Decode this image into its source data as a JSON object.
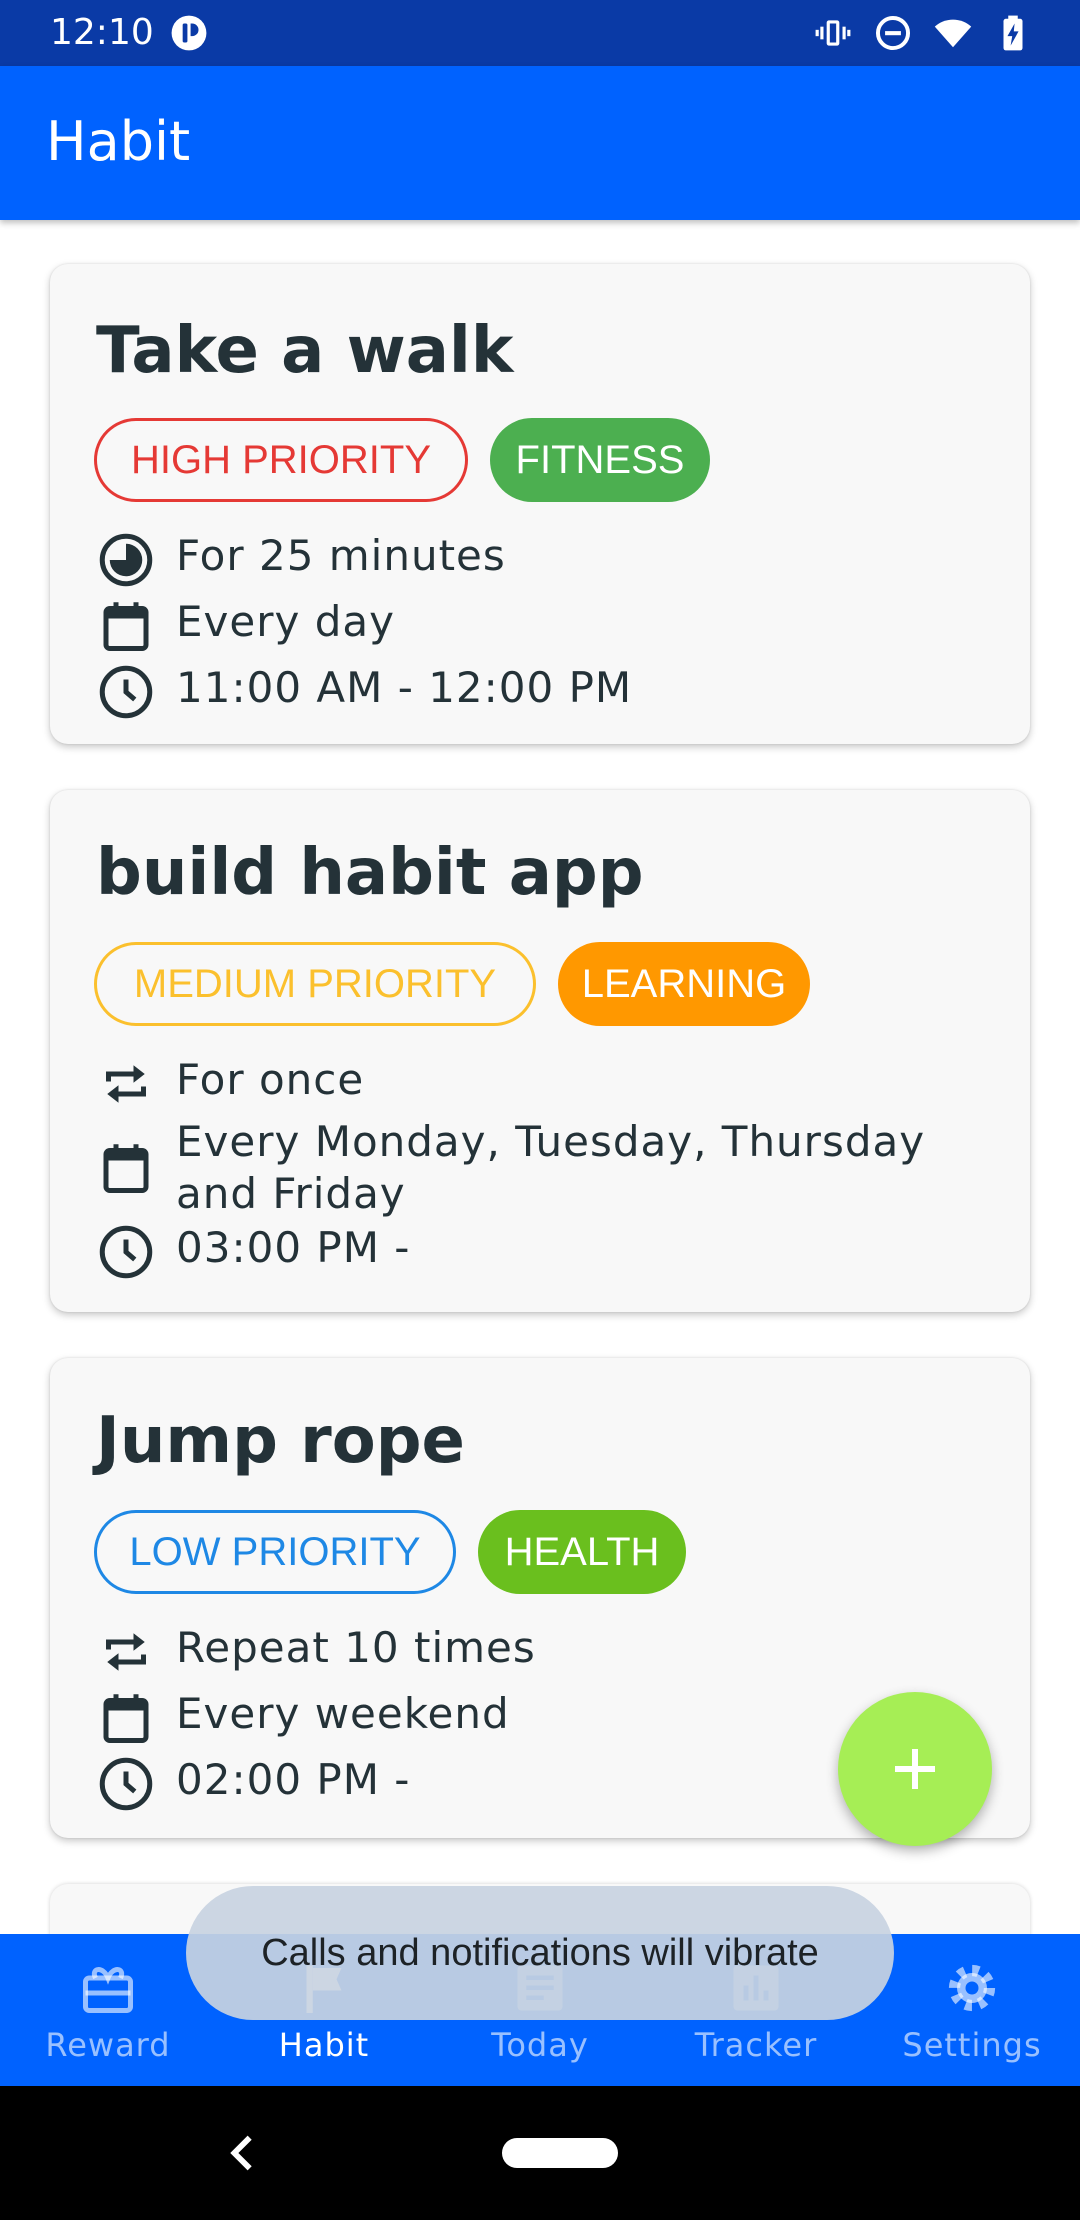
{
  "status_bar": {
    "time": "12:10"
  },
  "app_bar": {
    "title": "Habit"
  },
  "colors": {
    "primary": "#0062ff",
    "status_bar": "#0a3aa6",
    "fab": "#a6ee55",
    "high_priority": "#e53935",
    "medium_priority": "#fbc02d",
    "low_priority": "#1e88e5",
    "fitness": "#4caf50",
    "learning": "#ff9800",
    "health": "#6abf1e"
  },
  "habits": [
    {
      "title": "Take a walk",
      "priority": "HIGH PRIORITY",
      "category": "FITNESS",
      "details": [
        {
          "icon": "timer-icon",
          "text": "For 25 minutes"
        },
        {
          "icon": "calendar-icon",
          "text": "Every day"
        },
        {
          "icon": "clock-icon",
          "text": "11:00 AM - 12:00 PM"
        }
      ]
    },
    {
      "title": "build habit app",
      "priority": "MEDIUM PRIORITY",
      "category": "LEARNING",
      "details": [
        {
          "icon": "repeat-icon",
          "text": "For once"
        },
        {
          "icon": "calendar-icon",
          "text": "Every Monday, Tuesday, Thursday and Friday"
        },
        {
          "icon": "clock-icon",
          "text": "03:00 PM -"
        }
      ]
    },
    {
      "title": "Jump rope",
      "priority": "LOW PRIORITY",
      "category": "HEALTH",
      "details": [
        {
          "icon": "repeat-icon",
          "text": "Repeat 10 times"
        },
        {
          "icon": "calendar-icon",
          "text": "Every weekend"
        },
        {
          "icon": "clock-icon",
          "text": "02:00 PM -"
        }
      ]
    }
  ],
  "fab": {
    "icon": "plus-icon"
  },
  "bottom_nav": [
    {
      "label": "Reward",
      "icon": "gift-icon",
      "active": false
    },
    {
      "label": "Habit",
      "icon": "flag-icon",
      "active": true
    },
    {
      "label": "Today",
      "icon": "note-icon",
      "active": false
    },
    {
      "label": "Tracker",
      "icon": "bar-chart-icon",
      "active": false
    },
    {
      "label": "Settings",
      "icon": "gear-icon",
      "active": false
    }
  ],
  "toast": {
    "message": "Calls and notifications will vibrate"
  }
}
